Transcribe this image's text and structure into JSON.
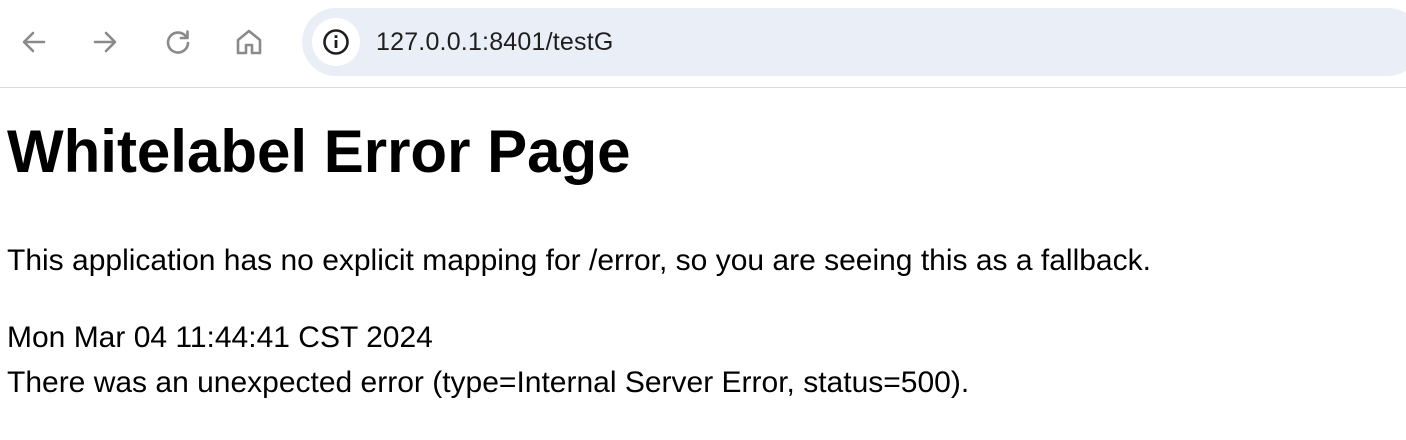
{
  "browser": {
    "url": "127.0.0.1:8401/testG",
    "icons": {
      "back": "arrow-left-icon",
      "forward": "arrow-right-icon",
      "reload": "reload-icon",
      "home": "home-icon",
      "site_info": "info-icon"
    }
  },
  "page": {
    "title": "Whitelabel Error Page",
    "message": "This application has no explicit mapping for /error, so you are seeing this as a fallback.",
    "timestamp": "Mon Mar 04 11:44:41 CST 2024",
    "error_detail": "There was an unexpected error (type=Internal Server Error, status=500)."
  },
  "colors": {
    "omnibox_bg": "#eaeef6",
    "icon_gray": "#7a7a7a",
    "text": "#000000"
  }
}
